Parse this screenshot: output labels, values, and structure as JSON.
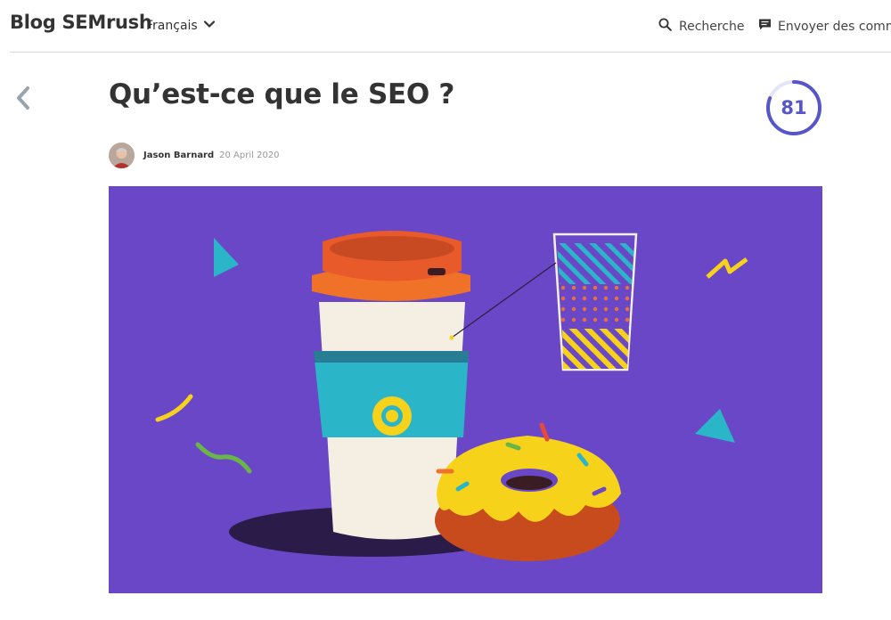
{
  "header": {
    "brand": "Blog SEMrush",
    "language": "Français",
    "search_label": "Recherche",
    "feedback_label": "Envoyer des commen"
  },
  "article": {
    "title": "Qu’est-ce que le SEO ?",
    "score": "81",
    "score_fraction": 0.81,
    "author": "Jason Barnard",
    "date": "20 April 2020"
  },
  "colors": {
    "hero_bg": "#6a47c7",
    "accent": "#5656c8",
    "lid": "#e85a2a",
    "sleeve": "#2bb5c8",
    "icing": "#f7d21a"
  },
  "icons": {
    "language": "chevron-down-icon",
    "search": "search-icon",
    "feedback": "chat-icon",
    "back": "chevron-left-icon"
  }
}
